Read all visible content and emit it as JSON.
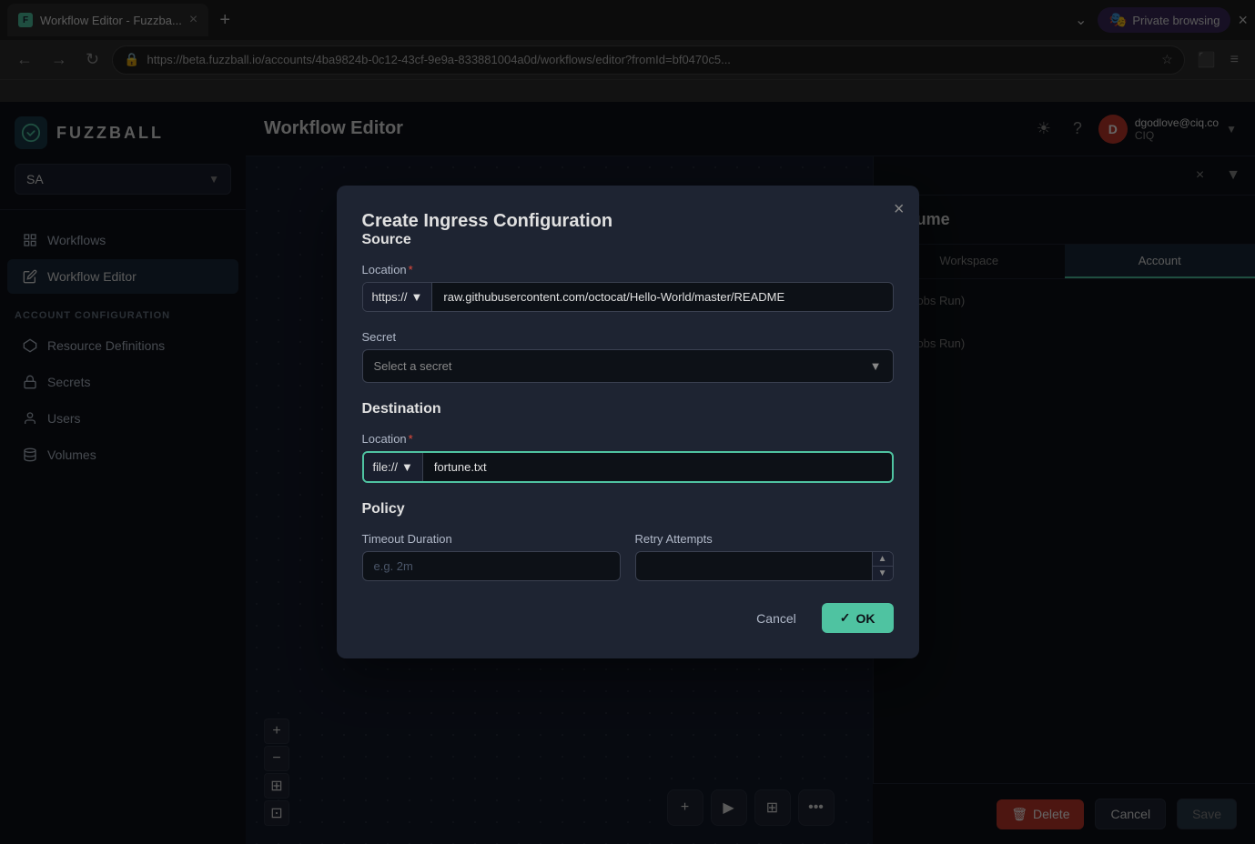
{
  "browser": {
    "tab_title": "Workflow Editor - Fuzzba...",
    "url": "https://beta.fuzzball.io/accounts/4ba9824b-0c12-43cf-9e9a-833881004a0d/workflows/editor?fromId=bf0470c5...",
    "private_browsing_label": "Private browsing",
    "new_tab_label": "+",
    "favicon_letter": "F"
  },
  "header": {
    "title": "Workflow Editor",
    "user_email": "dgodlove@ciq.co",
    "user_org": "CIQ",
    "user_initial": "D"
  },
  "sidebar": {
    "workspace": "SA",
    "items": [
      {
        "id": "workflows",
        "label": "Workflows",
        "icon": "☰"
      },
      {
        "id": "workflow-editor",
        "label": "Workflow Editor",
        "icon": "✏️"
      }
    ],
    "section_label": "ACCOUNT CONFIGURATION",
    "account_items": [
      {
        "id": "resource-definitions",
        "label": "Resource Definitions",
        "icon": "⬡"
      },
      {
        "id": "secrets",
        "label": "Secrets",
        "icon": "🔒"
      },
      {
        "id": "users",
        "label": "Users",
        "icon": "👤"
      },
      {
        "id": "volumes",
        "label": "Volumes",
        "icon": "💾"
      }
    ]
  },
  "right_panel": {
    "title": "Volume",
    "tab_workspace": "Workspace",
    "tab_account": "Account",
    "stat_label": "Jobs Run",
    "stat_label2": "Jobs Run"
  },
  "bottom_bar": {
    "delete_label": "Delete",
    "cancel_label": "Cancel",
    "save_label": "Save"
  },
  "modal": {
    "title": "Create Ingress Configuration",
    "source_section": "Source",
    "source_location_label": "Location",
    "source_protocol": "https://",
    "source_path": "raw.githubusercontent.com/octocat/Hello-World/master/README",
    "secret_label": "Secret",
    "secret_placeholder": "Select a secret",
    "destination_section": "Destination",
    "destination_location_label": "Location",
    "destination_protocol": "file://",
    "destination_path": "fortune.txt",
    "policy_section": "Policy",
    "timeout_label": "Timeout Duration",
    "timeout_placeholder": "e.g. 2m",
    "retry_label": "Retry Attempts",
    "cancel_label": "Cancel",
    "ok_label": "OK"
  },
  "canvas": {
    "zoom_plus": "+",
    "zoom_minus": "−",
    "zoom_fit": "⊞",
    "zoom_reset": "⊡"
  },
  "colors": {
    "accent": "#4fc3a1",
    "danger": "#c0392b",
    "bg_dark": "#0d1117",
    "bg_mid": "#1e2432",
    "border": "#2a3040"
  }
}
